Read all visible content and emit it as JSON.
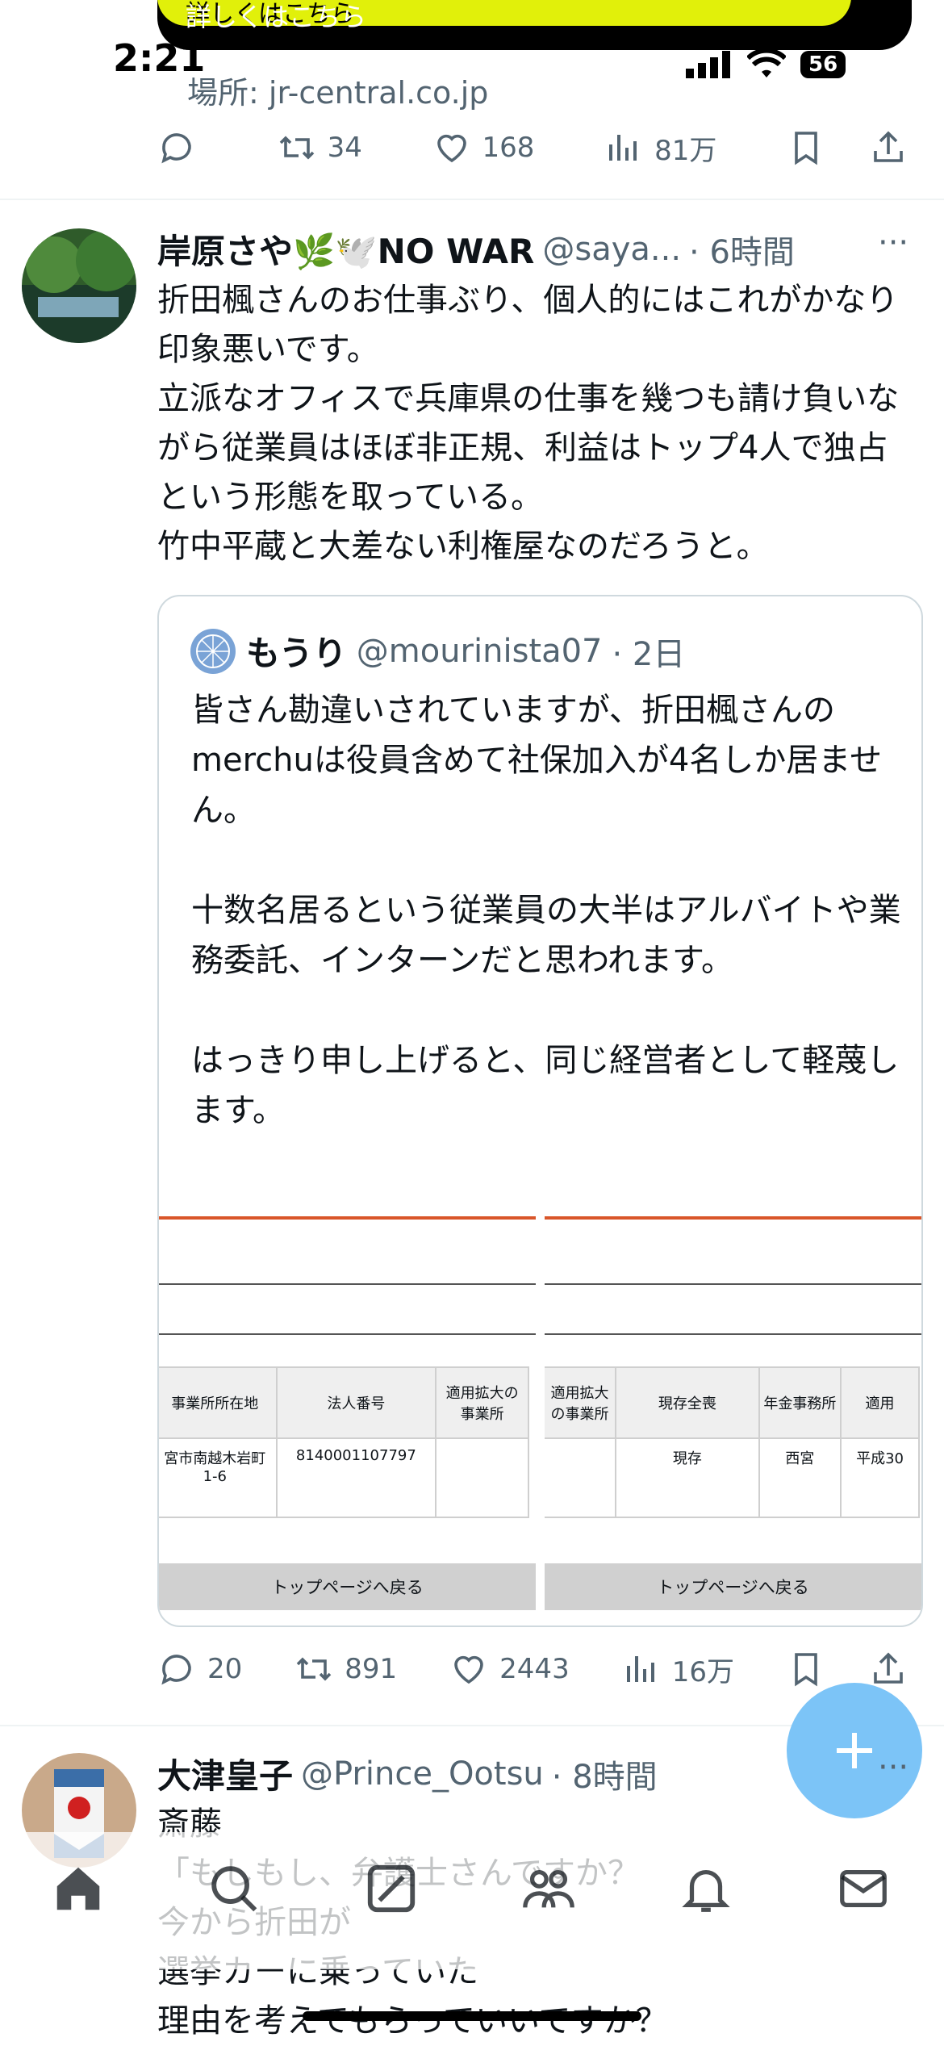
{
  "status_bar": {
    "time": "2:21",
    "battery": "56"
  },
  "ad": {
    "cta": "詳しくはこちら",
    "location": "場所: jr-central.co.jp"
  },
  "tweet_prev": {
    "actions": {
      "replies": "",
      "retweets": "34",
      "likes": "168",
      "views": "81万"
    }
  },
  "tweet1": {
    "author": "岸原さや🌿🕊️NO WAR",
    "handle": "@saya...",
    "time": "· 6時間",
    "text": "折田楓さんのお仕事ぶり、個人的にはこれがかなり印象悪いです。\n立派なオフィスで兵庫県の仕事を幾つも請け負いながら従業員はほぼ非正規、利益はトップ4人で独占という形態を取っている。\n竹中平蔵と大差ない利権屋なのだろうと。",
    "quote": {
      "author": "もうり",
      "handle": "@mourinista07",
      "time": "· 2日",
      "text": "皆さん勘違いされていますが、折田楓さんのmerchuは役員含めて社保加入が4名しか居ません。\n\n十数名居るという従業員の大半はアルバイトや業務委託、インターンだと思われます。\n\nはっきり申し上げると、同じ経営者として軽蔑します。",
      "doc_left": {
        "headers": [
          "事業所所在地",
          "法人番号",
          "適用拡大の事業所"
        ],
        "cells": [
          "宮市南越木岩町1-6",
          "8140001107797",
          ""
        ],
        "back": "トップページへ戻る"
      },
      "doc_right": {
        "headers": [
          "適用拡大の事業所",
          "現存全喪",
          "年金事務所",
          "適用"
        ],
        "cells": [
          "",
          "現存",
          "西宮",
          "平成30"
        ],
        "back": "トップページへ戻る"
      }
    },
    "actions": {
      "replies": "20",
      "retweets": "891",
      "likes": "2443",
      "views": "16万"
    }
  },
  "tweet2": {
    "author": "大津皇子",
    "handle": "@Prince_Ootsu",
    "time": "· 8時間",
    "text": "斎藤\n「もしもし、弁護士さんですか？\n今から折田が\n選挙カーに乗っていた\n理由を考えてもらっていいですか？"
  },
  "colors": {
    "accent": "#1d9bf0",
    "fab": "#7cc4f7",
    "muted": "#536471"
  },
  "icons": [
    "reply-icon",
    "retweet-icon",
    "like-icon",
    "views-icon",
    "bookmark-icon",
    "share-icon",
    "home-icon",
    "search-icon",
    "grok-icon",
    "communities-icon",
    "notifications-icon",
    "messages-icon",
    "compose-icon"
  ]
}
